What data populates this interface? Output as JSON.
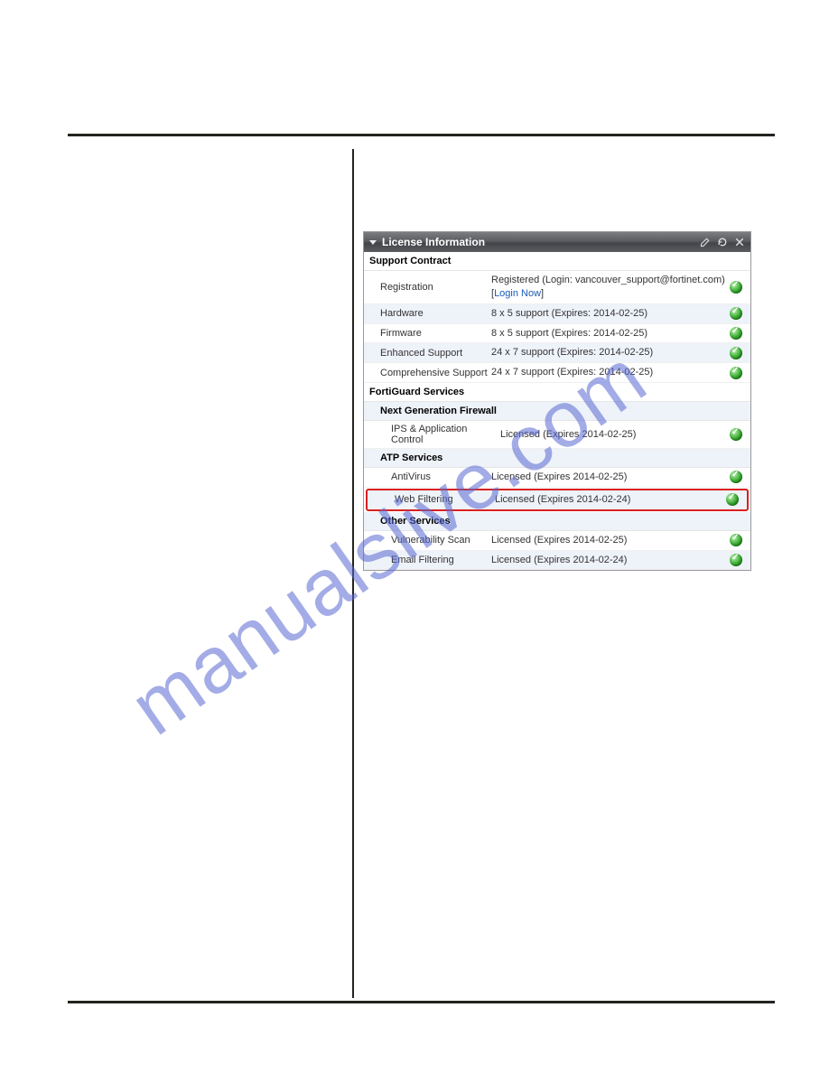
{
  "watermark": "manualslive.com",
  "widget": {
    "title": "License Information",
    "sections": {
      "support": {
        "heading": "Support Contract",
        "rows": [
          {
            "label": "Registration",
            "value_prefix": "Registered (Login: vancouver_support@fortinet.com)",
            "link_text": "Login Now"
          },
          {
            "label": "Hardware",
            "value": "8 x 5 support (Expires: 2014-02-25)"
          },
          {
            "label": "Firmware",
            "value": "8 x 5 support (Expires: 2014-02-25)"
          },
          {
            "label": "Enhanced Support",
            "value": "24 x 7 support (Expires: 2014-02-25)"
          },
          {
            "label": "Comprehensive Support",
            "value": "24 x 7 support (Expires: 2014-02-25)"
          }
        ]
      },
      "fortiguard": {
        "heading": "FortiGuard Services",
        "ngfw": {
          "heading": "Next Generation Firewall",
          "rows": [
            {
              "label": "IPS & Application Control",
              "value": "Licensed (Expires 2014-02-25)"
            }
          ]
        },
        "atp": {
          "heading": "ATP Services",
          "rows": [
            {
              "label": "AntiVirus",
              "value": "Licensed (Expires 2014-02-25)"
            },
            {
              "label": "Web Filtering",
              "value": "Licensed (Expires 2014-02-24)",
              "highlight": true
            }
          ]
        },
        "other": {
          "heading": "Other Services",
          "rows": [
            {
              "label": "Vulnerability Scan",
              "value": "Licensed (Expires 2014-02-25)"
            },
            {
              "label": "Email Filtering",
              "value": "Licensed (Expires 2014-02-24)"
            }
          ]
        }
      }
    }
  }
}
